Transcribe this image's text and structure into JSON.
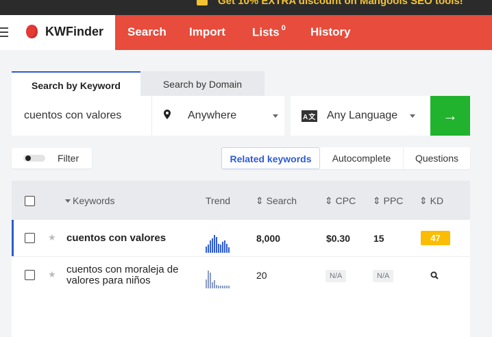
{
  "promo": {
    "text": "Get 10% EXTRA discount on Mangools SEO tools!"
  },
  "nav": {
    "brand": "KWFinder",
    "items": [
      {
        "label": "Search"
      },
      {
        "label": "Import"
      },
      {
        "label": "Lists",
        "badge": "0"
      },
      {
        "label": "History"
      }
    ]
  },
  "search": {
    "tabs": [
      "Search by Keyword",
      "Search by Domain"
    ],
    "keyword_value": "cuentos con valores",
    "location": "Anywhere",
    "language": "Any Language",
    "language_icon_text": "A文",
    "go_arrow": "→"
  },
  "filter": {
    "label": "Filter"
  },
  "result_tabs": [
    "Related keywords",
    "Autocomplete",
    "Questions"
  ],
  "table": {
    "headers": {
      "keywords": "Keywords",
      "trend": "Trend",
      "search": "Search",
      "cpc": "CPC",
      "ppc": "PPC",
      "kd": "KD"
    },
    "sort_glyph": "⇕",
    "rows": [
      {
        "keyword": "cuentos con valores",
        "search": "8,000",
        "cpc": "$0.30",
        "ppc": "15",
        "kd": "47",
        "trend": [
          0.35,
          0.45,
          0.7,
          0.8,
          1.0,
          0.9,
          0.5,
          0.45,
          0.6,
          0.7,
          0.5,
          0.3
        ]
      },
      {
        "keyword_line1": "cuentos con moraleja de",
        "keyword_line2": "valores para niños",
        "search": "20",
        "cpc": "N/A",
        "ppc": "N/A",
        "kd_icon": "magnifier-icon",
        "trend": [
          0.5,
          1.0,
          0.9,
          0.35,
          0.45,
          0.2,
          0.15,
          0.15,
          0.15,
          0.15,
          0.15,
          0.15
        ]
      }
    ]
  },
  "colors": {
    "nav_bg": "#e74c3c",
    "accent_blue": "#2f5bd3",
    "go_green": "#21b32d",
    "kd_badge": "#fbbc04"
  }
}
